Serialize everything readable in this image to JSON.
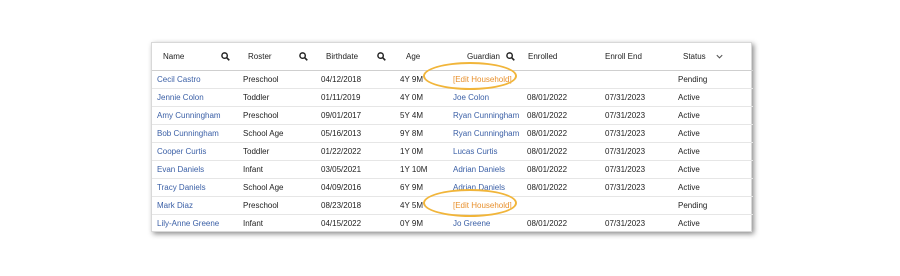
{
  "headers": {
    "name": "Name",
    "roster": "Roster",
    "birthdate": "Birthdate",
    "age": "Age",
    "guardian": "Guardian",
    "enrolled": "Enrolled",
    "enroll_end": "Enroll End",
    "status": "Status"
  },
  "rows": [
    {
      "name": "Cecil Castro",
      "roster": "Preschool",
      "birthdate": "04/12/2018",
      "age": "4Y 9M",
      "guardian": "[Edit Household]",
      "enrolled": "",
      "enroll_end": "",
      "status": "Pending"
    },
    {
      "name": "Jennie Colon",
      "roster": "Toddler",
      "birthdate": "01/11/2019",
      "age": "4Y 0M",
      "guardian": "Joe Colon",
      "enrolled": "08/01/2022",
      "enroll_end": "07/31/2023",
      "status": "Active"
    },
    {
      "name": "Amy Cunningham",
      "roster": "Preschool",
      "birthdate": "09/01/2017",
      "age": "5Y 4M",
      "guardian": "Ryan Cunningham",
      "enrolled": "08/01/2022",
      "enroll_end": "07/31/2023",
      "status": "Active"
    },
    {
      "name": "Bob Cunningham",
      "roster": "School Age",
      "birthdate": "05/16/2013",
      "age": "9Y 8M",
      "guardian": "Ryan Cunningham",
      "enrolled": "08/01/2022",
      "enroll_end": "07/31/2023",
      "status": "Active"
    },
    {
      "name": "Cooper Curtis",
      "roster": "Toddler",
      "birthdate": "01/22/2022",
      "age": "1Y 0M",
      "guardian": "Lucas Curtis",
      "enrolled": "08/01/2022",
      "enroll_end": "07/31/2023",
      "status": "Active"
    },
    {
      "name": "Evan Daniels",
      "roster": "Infant",
      "birthdate": "03/05/2021",
      "age": "1Y 10M",
      "guardian": "Adrian Daniels",
      "enrolled": "08/01/2022",
      "enroll_end": "07/31/2023",
      "status": "Active"
    },
    {
      "name": "Tracy Daniels",
      "roster": "School Age",
      "birthdate": "04/09/2016",
      "age": "6Y 9M",
      "guardian": "Adrian Daniels",
      "enrolled": "08/01/2022",
      "enroll_end": "07/31/2023",
      "status": "Active"
    },
    {
      "name": "Mark Diaz",
      "roster": "Preschool",
      "birthdate": "08/23/2018",
      "age": "4Y 5M",
      "guardian": "[Edit Household]",
      "enrolled": "",
      "enroll_end": "",
      "status": "Pending"
    },
    {
      "name": "Lily-Anne Greene",
      "roster": "Infant",
      "birthdate": "04/15/2022",
      "age": "0Y 9M",
      "guardian": "Jo Greene",
      "enrolled": "08/01/2022",
      "enroll_end": "07/31/2023",
      "status": "Active"
    }
  ],
  "colors": {
    "link": "#3a5fa6",
    "edit_household": "#e8902c",
    "highlight_ring": "#f1b53a"
  },
  "icons": {
    "column_search": "search-icon",
    "status_sort": "chevron-down-icon"
  }
}
